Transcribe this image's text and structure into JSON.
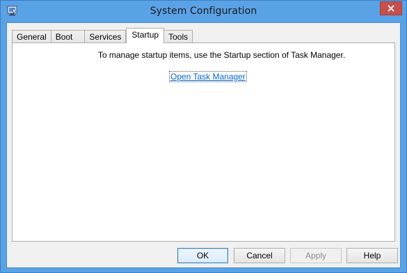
{
  "window": {
    "title": "System Configuration",
    "app_icon": "msconfig-icon",
    "close_icon": "close-icon"
  },
  "tabs": [
    {
      "label": "General",
      "active": false
    },
    {
      "label": "Boot",
      "active": false
    },
    {
      "label": "Services",
      "active": false
    },
    {
      "label": "Startup",
      "active": true
    },
    {
      "label": "Tools",
      "active": false
    }
  ],
  "startup": {
    "message": "To manage startup items, use the Startup section of Task Manager.",
    "link": "Open Task Manager"
  },
  "buttons": {
    "ok": "OK",
    "cancel": "Cancel",
    "apply": "Apply",
    "help": "Help"
  },
  "colors": {
    "title_bar": "#5aa2e6",
    "close_button": "#c7504c",
    "link": "#0066cc"
  }
}
